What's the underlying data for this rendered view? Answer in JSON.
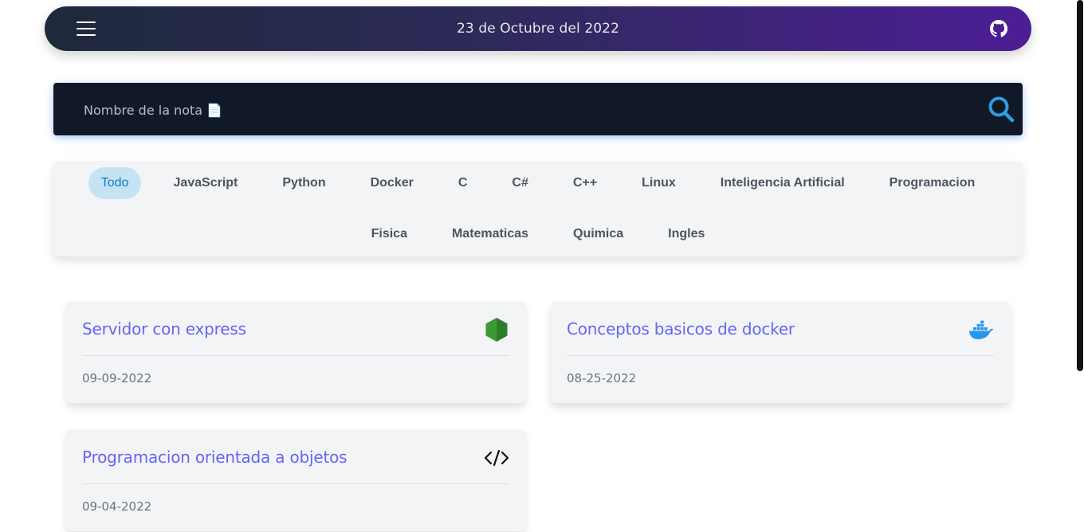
{
  "header": {
    "date": "23 de Octubre del 2022",
    "menu_icon": "hamburger-menu-icon",
    "github_icon": "github-icon"
  },
  "search": {
    "placeholder": "Nombre de la nota 📄",
    "value": "",
    "icon": "search-icon"
  },
  "categories": {
    "row1": [
      "Todo",
      "JavaScript",
      "Python",
      "Docker",
      "C",
      "C#",
      "C++",
      "Linux",
      "Inteligencia Artificial",
      "Programacion"
    ],
    "row2": [
      "Fisica",
      "Matematicas",
      "Quimica",
      "Ingles"
    ],
    "selected": "Todo"
  },
  "notes": [
    {
      "title": "Servidor con express",
      "date": "09-09-2022",
      "icon": "nodejs-icon"
    },
    {
      "title": "Conceptos basicos de docker",
      "date": "08-25-2022",
      "icon": "docker-icon"
    },
    {
      "title": "Programacion orientada a objetos",
      "date": "09-04-2022",
      "icon": "code-icon"
    }
  ],
  "colors": {
    "header_gradient_start": "#1e293b",
    "header_gradient_end": "#4c1d95",
    "search_bg": "#111827",
    "accent": "#6366f1",
    "active_category_bg": "#c5e3f3",
    "active_category_text": "#0b7ec1"
  }
}
